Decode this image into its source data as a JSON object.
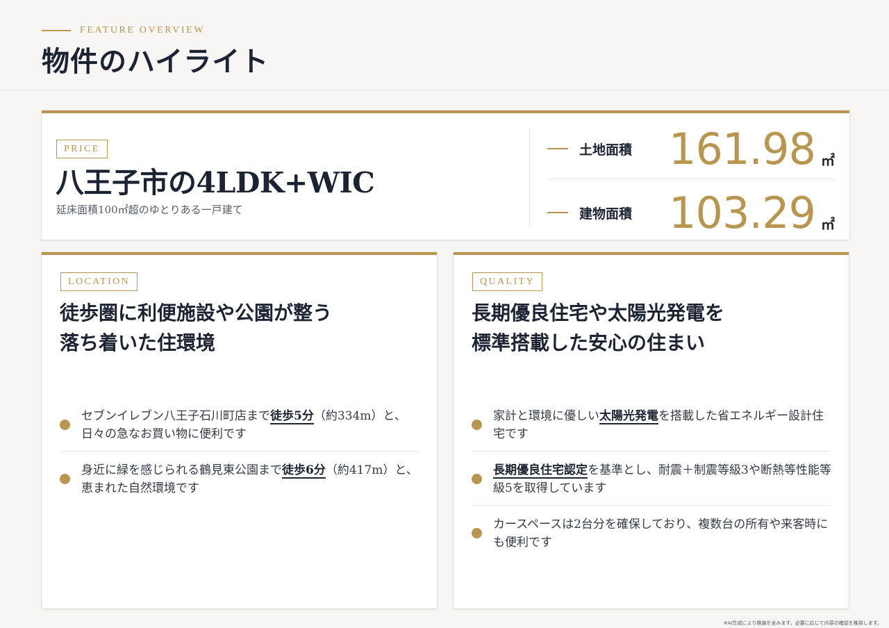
{
  "header": {
    "eyebrow": "FEATURE OVERVIEW",
    "title": "物件のハイライト"
  },
  "price_card": {
    "tag": "PRICE",
    "title": "八王子市の4LDK+WIC",
    "subtitle": "延床面積100㎡超のゆとりある一戸建て",
    "areas": [
      {
        "label": "土地面積",
        "value": "161.98",
        "unit": "㎡"
      },
      {
        "label": "建物面積",
        "value": "103.29",
        "unit": "㎡"
      }
    ]
  },
  "location_card": {
    "tag": "LOCATION",
    "heading_line1": "徒歩圏に利便施設や公園が整う",
    "heading_line2": "落ち着いた住環境",
    "items": [
      {
        "pre": "セブンイレブン八王子石川町店まで",
        "hl": "徒歩5分",
        "post": "（約334m）と、日々の急なお買い物に便利です"
      },
      {
        "pre": "身近に緑を感じられる鶴見東公園まで",
        "hl": "徒歩6分",
        "post": "（約417m）と、恵まれた自然環境です"
      }
    ]
  },
  "quality_card": {
    "tag": "QUALITY",
    "heading_line1": "長期優良住宅や太陽光発電を",
    "heading_line2": "標準搭載した安心の住まい",
    "items": [
      {
        "pre": "家計と環境に優しい",
        "hl": "太陽光発電",
        "post": "を搭載した省エネルギー設計住宅です"
      },
      {
        "pre": "",
        "hl": "長期優良住宅認定",
        "post": "を基準とし、耐震＋制震等級3や断熱等性能等級5を取得しています"
      },
      {
        "pre": "カースペースは2台分を確保しており、複数台の所有や来客時にも便利です",
        "hl": "",
        "post": ""
      }
    ]
  },
  "footnote": "※AI生成により推論を含みます。必要に応じて内容の確認を推奨します。",
  "colors": {
    "accent": "#b8964f",
    "text": "#1c2433",
    "background": "#f8f6f4"
  }
}
